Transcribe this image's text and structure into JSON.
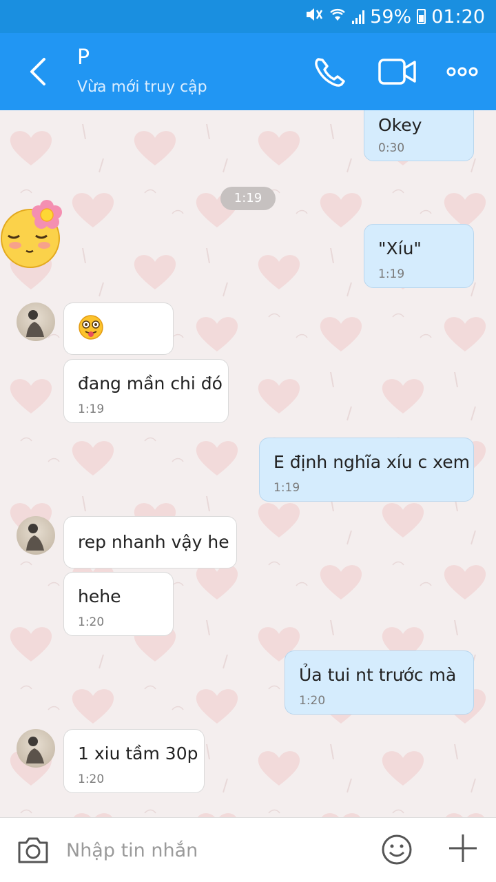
{
  "status_bar": {
    "battery": "59%",
    "time": "01:20"
  },
  "header": {
    "contact_name": "P",
    "contact_status": "Vừa mới truy cập",
    "back_icon": "chevron-left-icon",
    "call_icon": "phone-icon",
    "video_icon": "video-camera-icon",
    "more_icon": "more-dots-icon"
  },
  "chat": {
    "divider_time": "1:19",
    "messages": [
      {
        "side": "me",
        "text": "Okey",
        "time": "0:30"
      },
      {
        "side": "me",
        "text": "\"Xíu\"",
        "time": "1:19"
      },
      {
        "side": "them",
        "text": "😋",
        "time": ""
      },
      {
        "side": "them",
        "text": "đang mần chi đó",
        "time": "1:19"
      },
      {
        "side": "me",
        "text": "E định nghĩa xíu c xem",
        "time": "1:19"
      },
      {
        "side": "them",
        "text": "rep nhanh vậy he",
        "time": ""
      },
      {
        "side": "them",
        "text": "hehe",
        "time": "1:20"
      },
      {
        "side": "me",
        "text": "Ủa tui nt trước mà",
        "time": "1:20"
      },
      {
        "side": "them",
        "text": "1 xiu tầm 30p",
        "time": "1:20"
      }
    ]
  },
  "input_bar": {
    "placeholder": "Nhập tin nhắn",
    "value": ""
  },
  "colors": {
    "header_bg": "#2196f3",
    "status_bg": "#1a8fe0",
    "my_bubble": "#d5ecfd",
    "their_bubble": "#ffffff"
  }
}
